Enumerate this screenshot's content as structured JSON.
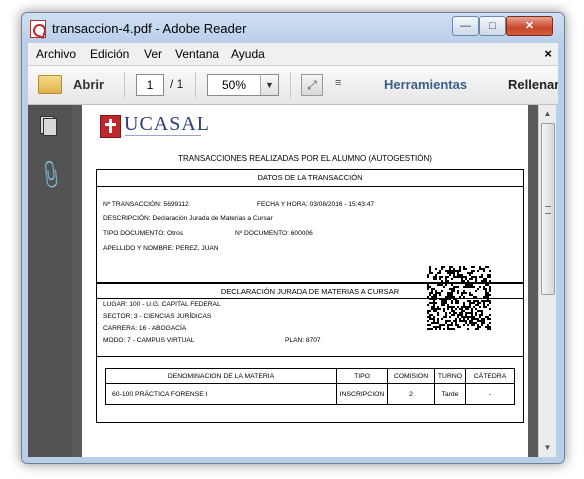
{
  "window": {
    "title": "transaccion-4.pdf - Adobe Reader",
    "minimize": "—",
    "maximize": "□",
    "close": "✕"
  },
  "menu": {
    "items": [
      "Archivo",
      "Edición",
      "Ver",
      "Ventana",
      "Ayuda"
    ],
    "close": "×"
  },
  "toolbar": {
    "open_label": "Abrir",
    "page_current": "1",
    "page_total": "/ 1",
    "zoom": "50%",
    "tools_label": "Herramientas",
    "fill_label": "Rellenar y firmar"
  },
  "document": {
    "logo_text": "UCASAL",
    "title": "TRANSACCIONES REALIZADAS POR EL ALUMNO (AUTOGESTIÓN)",
    "transaction": {
      "heading": "DATOS DE LA TRANSACCIÓN",
      "number": "Nº TRANSACCIÓN: 5699112",
      "datetime": "FECHA Y HORA: 03/08/2016 - 15:43:47",
      "description": "DESCRIPCIÓN: Declaración Jurada de Materias a Cursar",
      "doc_type": "TIPO DOCUMENTO: Otros",
      "doc_number": "Nº DOCUMENTO: 600006",
      "name": "APELLIDO Y NOMBRE: PEREZ, JUAN"
    },
    "declaration": {
      "heading": "DECLARACIÓN JURADA DE MATERIAS A CURSAR",
      "place": "LUGAR: 100 - U.G. CAPITAL FEDERAL",
      "sector": "SECTOR: 3 - CIENCIAS JURÍDICAS",
      "career": "CARRERA: 16 - ABOGACÍA",
      "mode": "MODO: 7 - CAMPUS VIRTUAL",
      "plan": "PLAN: 8707",
      "table": {
        "headers": [
          "DENOMINACION DE LA MATERIA",
          "TIPO",
          "COMISION",
          "TURNO",
          "CÁTEDRA"
        ],
        "row": {
          "subject": "60-100   PRÁCTICA FORENSE I",
          "type": "INSCRIPCION",
          "commission": "2",
          "shift": "Tarde",
          "chair": "-"
        }
      }
    }
  }
}
